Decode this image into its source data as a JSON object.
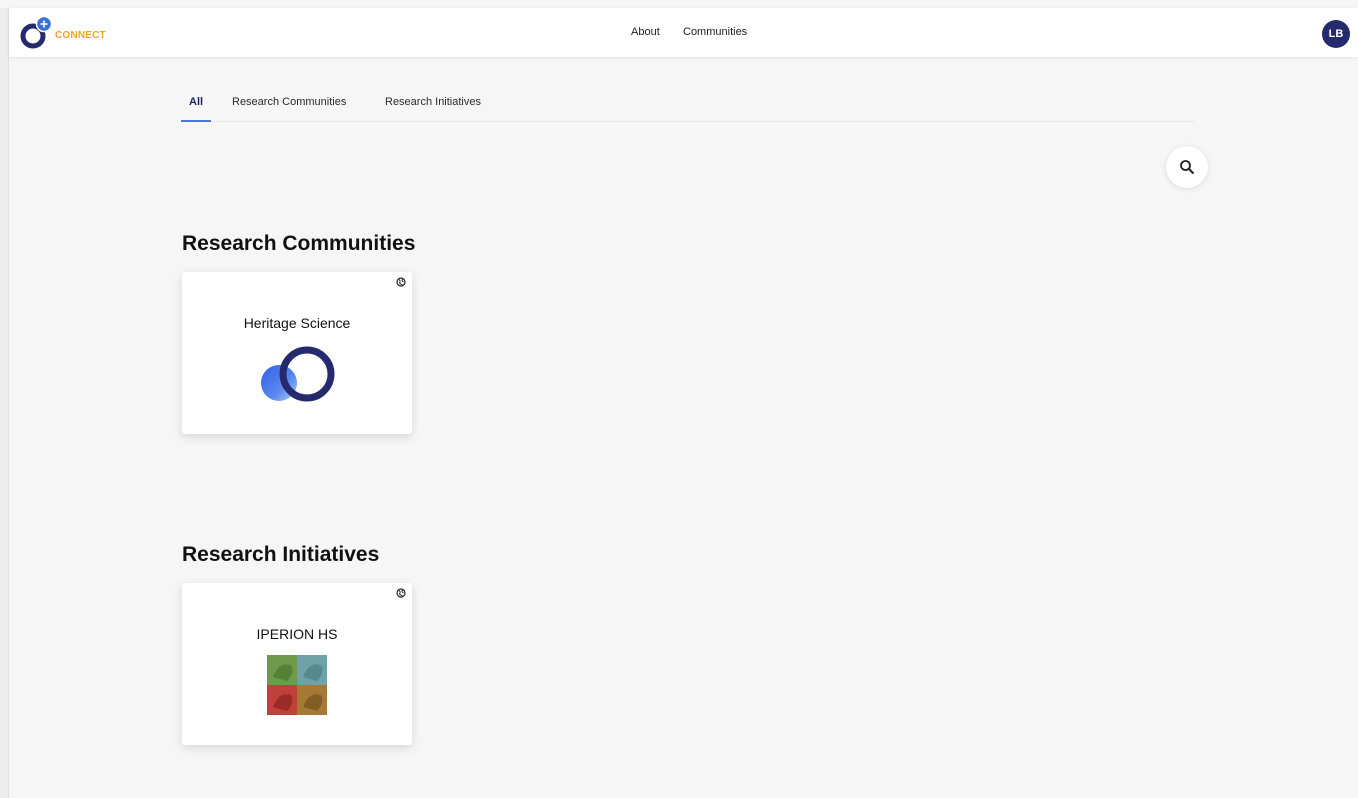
{
  "navbar": {
    "logo_text": "CONNECT",
    "links": {
      "about": "About",
      "communities": "Communities"
    },
    "avatar_initials": "LB"
  },
  "tabs": {
    "all": "All",
    "research_communities": "Research Communities",
    "research_initiatives": "Research Initiatives",
    "active": "All"
  },
  "sections": {
    "research_communities": {
      "title": "Research Communities",
      "cards": [
        {
          "title": "Heritage Science",
          "icon": "globe-icon"
        }
      ]
    },
    "research_initiatives": {
      "title": "Research Initiatives",
      "cards": [
        {
          "title": "IPERION HS",
          "icon": "globe-icon"
        }
      ]
    }
  },
  "colors": {
    "accent": "#242a6b",
    "logo_text": "#f0a32a",
    "tab_underline": "#4a76d4",
    "background": "#f6f6f6"
  }
}
